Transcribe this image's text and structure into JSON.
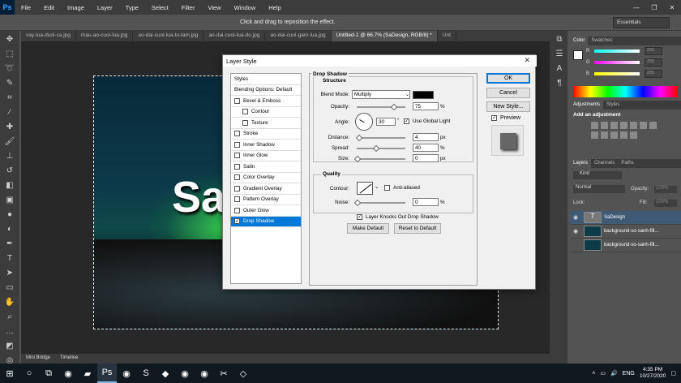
{
  "menu": {
    "logo": "Ps",
    "items": [
      "File",
      "Edit",
      "Image",
      "Layer",
      "Type",
      "Select",
      "Filter",
      "View",
      "Window",
      "Help"
    ]
  },
  "window_controls": [
    "—",
    "❐",
    "✕"
  ],
  "options_bar": {
    "hint": "Click and drag to reposition the effect.",
    "workspace": "Essentials"
  },
  "doc_tabs": [
    "vay-lua-duoi-ca.jpg",
    "mau-ao-cuoi-lua.jpg",
    "ao-dai-cuoi-lua-to-tam.jpg",
    "ao-dai-cuoi-lua-do.jpg",
    "ao-dai-cuoi-gam-lua.jpg",
    "Untitled-1 @ 66.7% (SaDesign, RGB/8) *",
    "Unt"
  ],
  "canvas": {
    "text": "Sa"
  },
  "bottom_tabs": [
    "Mini Bridge",
    "Timeline"
  ],
  "dialog": {
    "title": "Layer Style",
    "close": "✕",
    "styles_list": [
      {
        "label": "Styles",
        "checkbox": false,
        "checked": false,
        "sub": false,
        "selected": false
      },
      {
        "label": "Blending Options: Default",
        "checkbox": false,
        "checked": false,
        "sub": false,
        "selected": false
      },
      {
        "label": "Bevel & Emboss",
        "checkbox": true,
        "checked": false,
        "sub": false,
        "selected": false
      },
      {
        "label": "Contour",
        "checkbox": true,
        "checked": false,
        "sub": true,
        "selected": false
      },
      {
        "label": "Texture",
        "checkbox": true,
        "checked": false,
        "sub": true,
        "selected": false
      },
      {
        "label": "Stroke",
        "checkbox": true,
        "checked": false,
        "sub": false,
        "selected": false
      },
      {
        "label": "Inner Shadow",
        "checkbox": true,
        "checked": false,
        "sub": false,
        "selected": false
      },
      {
        "label": "Inner Glow",
        "checkbox": true,
        "checked": false,
        "sub": false,
        "selected": false
      },
      {
        "label": "Satin",
        "checkbox": true,
        "checked": false,
        "sub": false,
        "selected": false
      },
      {
        "label": "Color Overlay",
        "checkbox": true,
        "checked": false,
        "sub": false,
        "selected": false
      },
      {
        "label": "Gradient Overlay",
        "checkbox": true,
        "checked": false,
        "sub": false,
        "selected": false
      },
      {
        "label": "Pattern Overlay",
        "checkbox": true,
        "checked": false,
        "sub": false,
        "selected": false
      },
      {
        "label": "Outer Glow",
        "checkbox": true,
        "checked": false,
        "sub": false,
        "selected": false
      },
      {
        "label": "Drop Shadow",
        "checkbox": true,
        "checked": true,
        "sub": false,
        "selected": true
      }
    ],
    "section_title": "Drop Shadow",
    "structure": {
      "title": "Structure",
      "blend_mode_label": "Blend Mode:",
      "blend_mode_value": "Multiply",
      "shadow_color": "#000000",
      "opacity_label": "Opacity:",
      "opacity_value": "75",
      "opacity_unit": "%",
      "angle_label": "Angle:",
      "angle_value": "30",
      "angle_unit": "°",
      "use_global_light": "Use Global Light",
      "use_global_light_checked": true,
      "distance_label": "Distance:",
      "distance_value": "4",
      "distance_unit": "px",
      "spread_label": "Spread:",
      "spread_value": "40",
      "spread_unit": "%",
      "size_label": "Size:",
      "size_value": "0",
      "size_unit": "px"
    },
    "quality": {
      "title": "Quality",
      "contour_label": "Contour:",
      "anti_aliased": "Anti-aliased",
      "anti_aliased_checked": false,
      "noise_label": "Noise:",
      "noise_value": "0",
      "noise_unit": "%"
    },
    "layer_knocks_out": "Layer Knocks Out Drop Shadow",
    "layer_knocks_out_checked": true,
    "make_default": "Make Default",
    "reset_to_default": "Reset to Default",
    "ok": "OK",
    "cancel": "Cancel",
    "new_style": "New Style...",
    "preview_label": "Preview",
    "preview_checked": true
  },
  "panels": {
    "color_tabs": [
      "Color",
      "Swatches"
    ],
    "color_channels": [
      {
        "label": "R",
        "value": "255"
      },
      {
        "label": "G",
        "value": "255"
      },
      {
        "label": "B",
        "value": "255"
      }
    ],
    "adjust_tabs": [
      "Adjustments",
      "Styles"
    ],
    "adjust_title": "Add an adjustment",
    "layer_tabs": [
      "Layers",
      "Channels",
      "Paths"
    ],
    "kind_label": "Kind",
    "blend_label": "Normal",
    "opacity_label": "Opacity:",
    "opacity_value": "100%",
    "lock_label": "Lock:",
    "fill_label": "Fill:",
    "fill_value": "100%",
    "layers": [
      {
        "name": "SaDesign",
        "type": "text",
        "selected": true
      },
      {
        "name": "background-so-sanh-fill...",
        "type": "image",
        "selected": false
      },
      {
        "name": "background-so-sanh-fill...",
        "type": "image",
        "selected": false
      }
    ]
  },
  "taskbar": {
    "lang": "ENG",
    "time": "4:35 PM",
    "date": "10/27/2020"
  }
}
